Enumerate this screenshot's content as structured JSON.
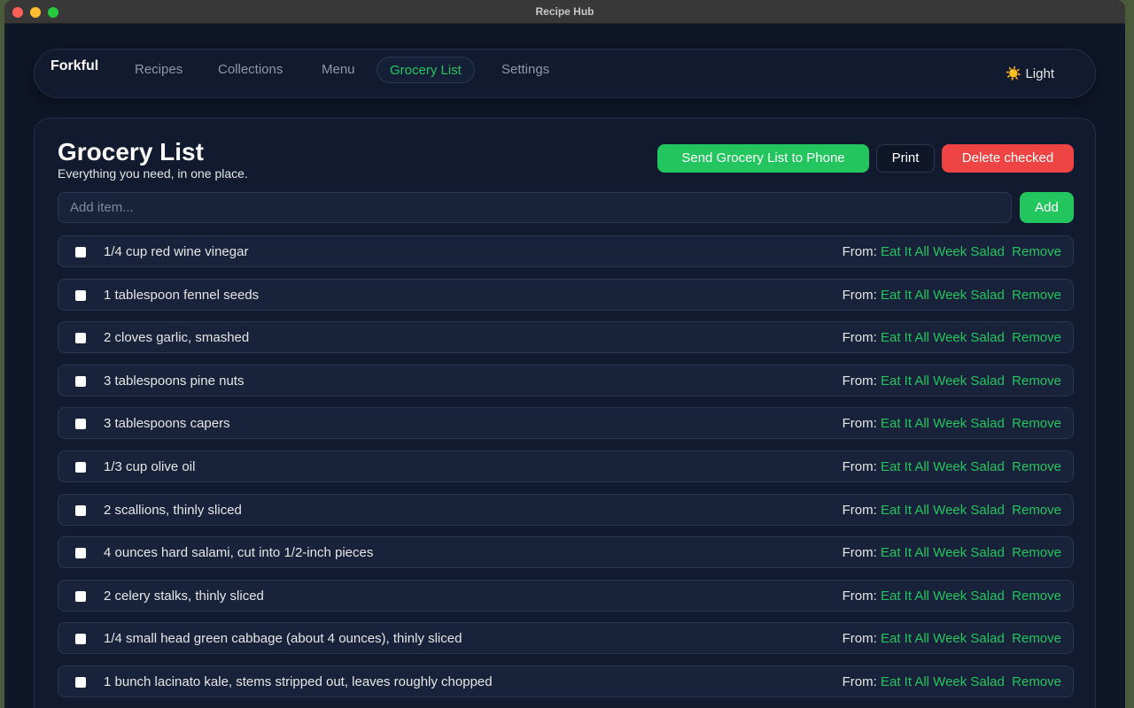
{
  "window": {
    "title": "Recipe Hub"
  },
  "nav": {
    "brand": "Forkful",
    "items": [
      "Recipes",
      "Collections",
      "Menu",
      "Grocery List",
      "Settings"
    ],
    "active": "Grocery List",
    "theme_label": "Light"
  },
  "page": {
    "title": "Grocery List",
    "subtitle": "Everything you need, in one place.",
    "send_label": "Send Grocery List to Phone",
    "print_label": "Print",
    "delete_label": "Delete checked",
    "add_placeholder": "Add item...",
    "add_label": "Add",
    "from_label": "From:",
    "remove_label": "Remove"
  },
  "items": [
    {
      "text": "1/4 cup red wine vinegar",
      "source": "Eat It All Week Salad"
    },
    {
      "text": "1 tablespoon fennel seeds",
      "source": "Eat It All Week Salad"
    },
    {
      "text": "2 cloves garlic, smashed",
      "source": "Eat It All Week Salad"
    },
    {
      "text": "3 tablespoons pine nuts",
      "source": "Eat It All Week Salad"
    },
    {
      "text": "3 tablespoons capers",
      "source": "Eat It All Week Salad"
    },
    {
      "text": "1/3 cup olive oil",
      "source": "Eat It All Week Salad"
    },
    {
      "text": "2 scallions, thinly sliced",
      "source": "Eat It All Week Salad"
    },
    {
      "text": "4 ounces hard salami, cut into 1/2-inch pieces",
      "source": "Eat It All Week Salad"
    },
    {
      "text": "2 celery stalks, thinly sliced",
      "source": "Eat It All Week Salad"
    },
    {
      "text": "1/4 small head green cabbage (about 4 ounces), thinly sliced",
      "source": "Eat It All Week Salad"
    },
    {
      "text": "1 bunch lacinato kale, stems stripped out, leaves roughly chopped",
      "source": "Eat It All Week Salad"
    }
  ]
}
